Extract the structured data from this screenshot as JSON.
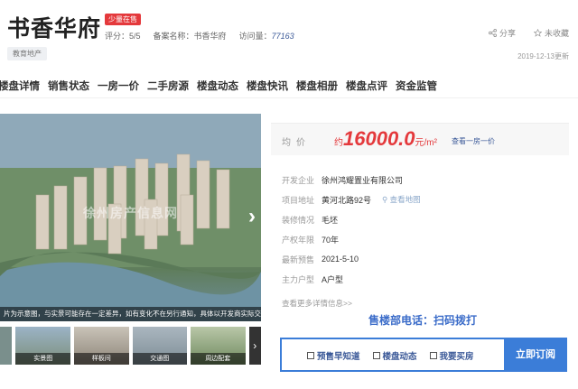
{
  "header": {
    "title": "书香华府",
    "badge": "少量在售",
    "score_label": "评分：",
    "score_value": "5/5",
    "record_label": "备案名称：",
    "record_value": "书香华府",
    "visits_label": "访问量：",
    "visits_value": "77163",
    "tag": "教育地产",
    "share_label": "分享",
    "favorite_label": "未收藏",
    "update_date": "2019-12-13更新"
  },
  "nav": {
    "items": [
      "楼盘详情",
      "销售状态",
      "一房一价",
      "二手房源",
      "楼盘动态",
      "楼盘快讯",
      "楼盘相册",
      "楼盘点评",
      "资金监管"
    ]
  },
  "gallery": {
    "caption": "片为示意图，与实景可能存在一定差异，如有变化不在另行通知，具体以开发商实际交付为准。",
    "watermark": "徐州房产信息网",
    "thumbs": [
      "",
      "实景图",
      "样板间",
      "交通图",
      "周边配套"
    ]
  },
  "info": {
    "price_label": "均价",
    "price_prefix": "约",
    "price_value": "16000.0",
    "price_unit": "元/m²",
    "price_link": "查看一房一价",
    "rows": [
      {
        "key": "开发企业",
        "value": "徐州鸿耀置业有限公司"
      },
      {
        "key": "项目地址",
        "value": "黄河北路92号"
      },
      {
        "key": "装修情况",
        "value": "毛坯"
      },
      {
        "key": "产权年限",
        "value": "70年"
      },
      {
        "key": "最新预售",
        "value": "2021-5-10"
      },
      {
        "key": "主力户型",
        "value": "A户型"
      }
    ],
    "map_link": "查看地图",
    "more_link": "查看更多详情信息>>",
    "hotline": "售楼部电话：扫码拨打"
  },
  "subscribe": {
    "options": [
      "预售早知道",
      "楼盘动态",
      "我要买房"
    ],
    "button": "立即订阅"
  }
}
